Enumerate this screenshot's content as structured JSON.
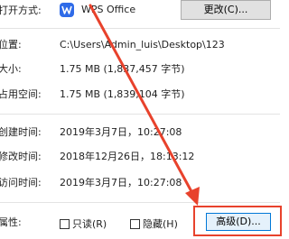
{
  "open_with": {
    "label": "打开方式:",
    "app_name": "WPS Office",
    "app_icon": "wps-office-icon",
    "change_button": "更改(C)..."
  },
  "rows": {
    "location": {
      "label": "位置:",
      "value": "C:\\Users\\Admin_luis\\Desktop\\123"
    },
    "size": {
      "label": "大小:",
      "value": "1.75 MB (1,837,457 字节)"
    },
    "size_on_disk": {
      "label": "占用空间:",
      "value": "1.75 MB (1,839,104 字节)"
    },
    "created": {
      "label": "创建时间:",
      "value": "2019年3月7日，10:27:08"
    },
    "modified": {
      "label": "修改时间:",
      "value": "2018年12月26日，18:13:12"
    },
    "accessed": {
      "label": "访问时间:",
      "value": "2019年3月7日，10:27:08"
    }
  },
  "attributes": {
    "label": "属性:",
    "readonly": "只读(R)",
    "hidden": "隐藏(H)",
    "advanced_button": "高级(D)..."
  },
  "colors": {
    "annotation_red": "#e8422c",
    "wps_blue": "#2f6be8"
  }
}
